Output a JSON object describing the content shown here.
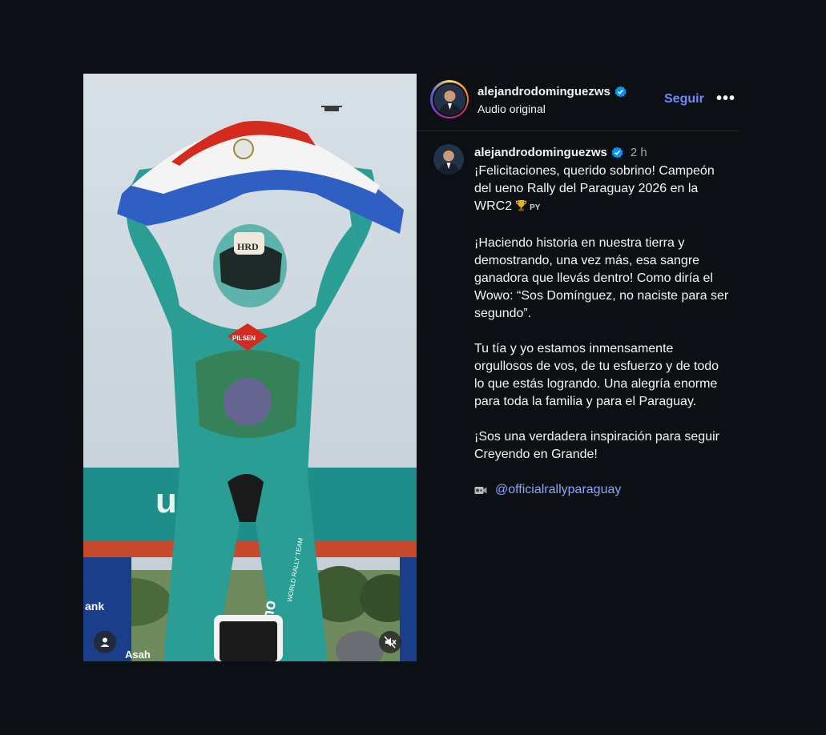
{
  "post": {
    "username": "alejandrodominguezws",
    "audio": "Audio original",
    "follow_label": "Seguir",
    "more_label": "•••"
  },
  "caption": {
    "username": "alejandrodominguezws",
    "time": "2 h",
    "p1_line": "¡Felicitaciones, querido sobrino! Campeón del ueno Rally del Paraguay 2026 en la WRC2",
    "py_tag": "PY",
    "p2": "¡Haciendo historia en nuestra tierra y demostrando, una vez más, esa sangre ganadora que llevás dentro! Como diría el Wowo: “Sos Domínguez, no naciste para ser segundo”.",
    "p3": "Tu tía y yo estamos inmensamente orgullosos de vos, de tu esfuerzo y de todo lo que estás logrando. Una alegría enorme para toda la familia y para el Paraguay.",
    "p4": "¡Sos una verdadera inspiración para seguir Creyendo en Grande!",
    "mention": "@officialrallyparaguay"
  },
  "media": {
    "banner_text": "u   ank",
    "banner_left_text": "ank",
    "banner_bottom_text": "Asah",
    "helmet_text": "HRD",
    "suit_logo_text": "PILSEN",
    "suit_text": "ueno",
    "suit_side_text": "WORLD RALLY TEAM"
  },
  "colors": {
    "background": "#0c1014",
    "accent_link": "#6b8cff",
    "mention": "#8aa5ff",
    "suit": "#2a9d94",
    "banner": "#1f8e8a"
  },
  "icons": {
    "verified": "verified-badge-icon",
    "trophy": "trophy-icon",
    "camera": "video-camera-icon",
    "user": "user-tag-icon",
    "mute": "muted-speaker-icon"
  }
}
